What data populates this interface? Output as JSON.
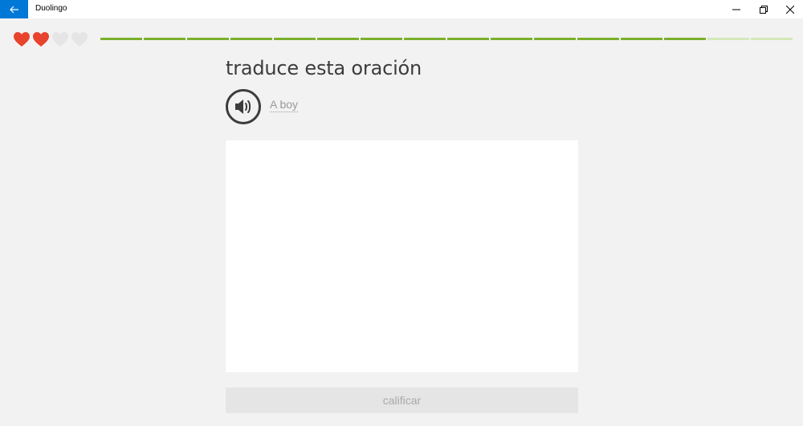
{
  "window": {
    "title": "Duolingo"
  },
  "lesson": {
    "hearts_total": 4,
    "hearts_remaining": 2,
    "progress_segments_total": 16,
    "progress_segments_done": 14,
    "prompt": "traduce esta oración",
    "sentence": "A boy",
    "answer_value": "",
    "check_label": "calificar"
  },
  "colors": {
    "heart_full": "#e8432c",
    "heart_empty": "#e5e5e5",
    "progress_done": "#7ab02c",
    "progress_todo": "#d3e8b8",
    "accent": "#0078d7"
  }
}
